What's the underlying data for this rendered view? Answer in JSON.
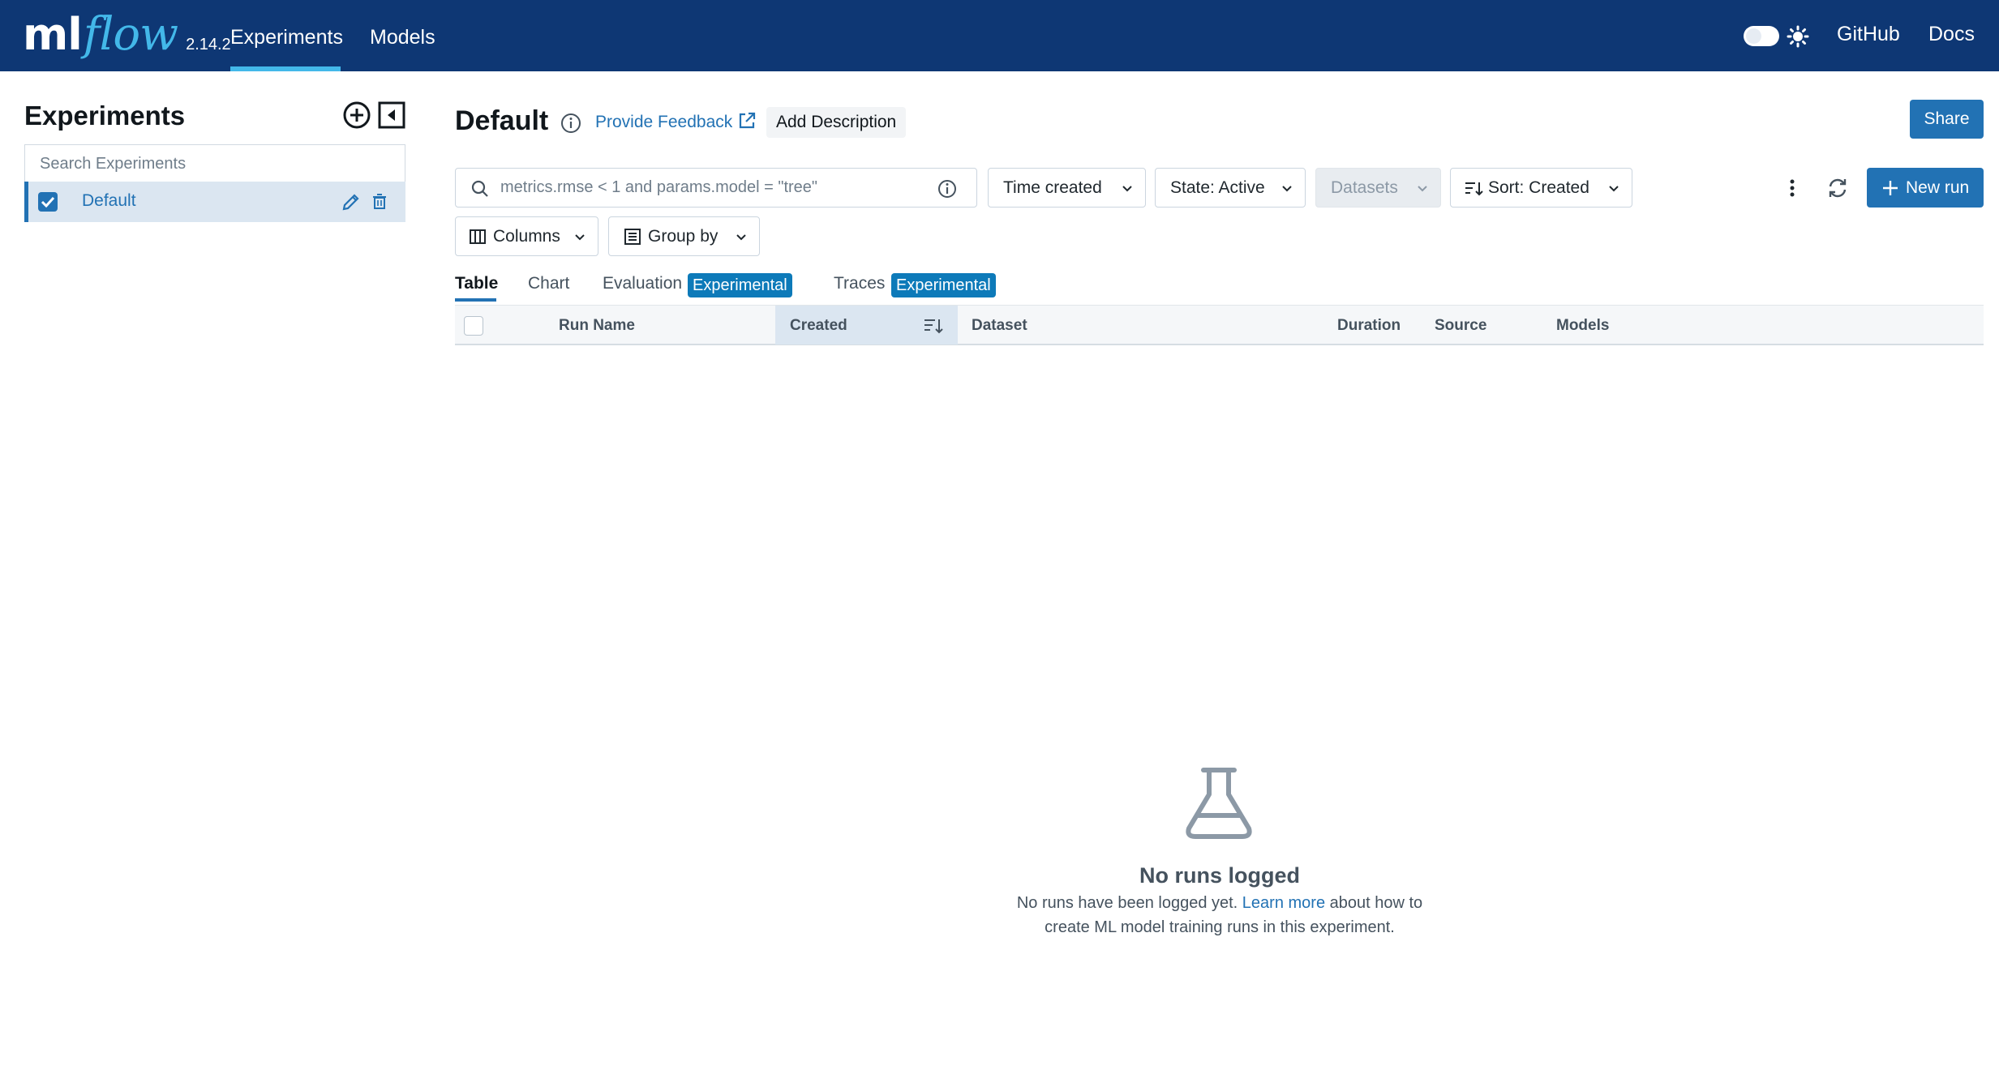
{
  "header": {
    "logo_ml": "ml",
    "logo_flow": "flow",
    "version": "2.14.2",
    "nav": [
      {
        "label": "Experiments",
        "active": true
      },
      {
        "label": "Models",
        "active": false
      }
    ],
    "links": [
      "GitHub",
      "Docs"
    ],
    "brand_color": "#0e3774",
    "accent_color": "#43b8e9"
  },
  "sidebar": {
    "title": "Experiments",
    "search_placeholder": "Search Experiments",
    "items": [
      {
        "label": "Default",
        "checked": true
      }
    ]
  },
  "main": {
    "title": "Default",
    "feedback_label": "Provide Feedback",
    "add_description_label": "Add Description",
    "share_label": "Share",
    "search_placeholder": "metrics.rmse < 1 and params.model = \"tree\"",
    "filters": {
      "time_created": "Time created",
      "state": "State: Active",
      "datasets": "Datasets",
      "sort": "Sort: Created"
    },
    "new_run_label": "New run",
    "columns_label": "Columns",
    "group_by_label": "Group by",
    "tabs": [
      {
        "label": "Table",
        "active": true
      },
      {
        "label": "Chart",
        "active": false
      },
      {
        "label": "Evaluation",
        "badge": "Experimental"
      },
      {
        "label": "Traces",
        "badge": "Experimental"
      }
    ],
    "table_columns": [
      "Run Name",
      "Created",
      "Dataset",
      "Duration",
      "Source",
      "Models"
    ],
    "empty": {
      "title": "No runs logged",
      "text_before": "No runs have been logged yet. ",
      "link": "Learn more",
      "text_after": " about how to create ML model training runs in this experiment."
    },
    "primary_color": "#2272b4"
  }
}
